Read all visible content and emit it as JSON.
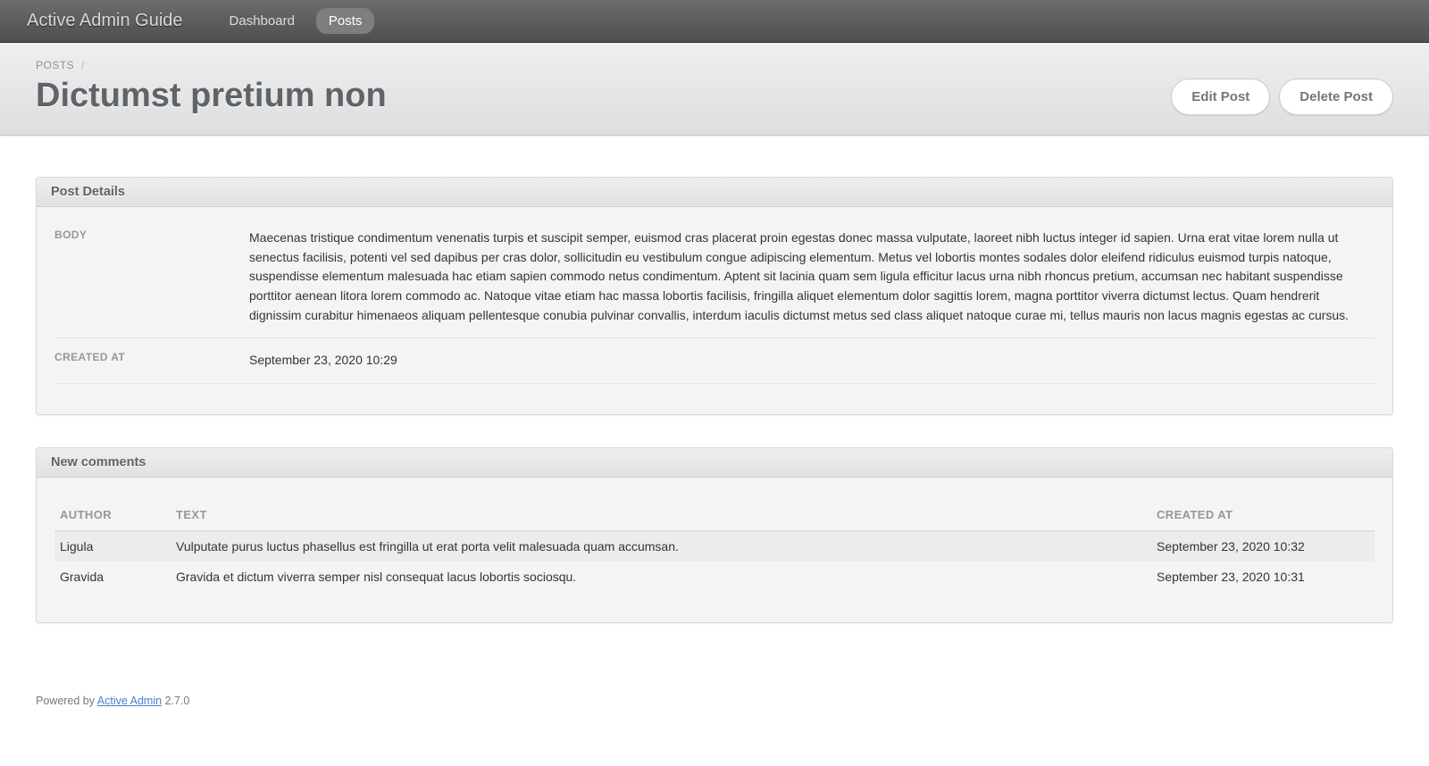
{
  "header": {
    "site_title": "Active Admin Guide",
    "nav": [
      {
        "label": "Dashboard",
        "active": false
      },
      {
        "label": "Posts",
        "active": true
      }
    ]
  },
  "breadcrumb": {
    "items": [
      {
        "label": "POSTS"
      }
    ],
    "sep": "/"
  },
  "page_title": "Dictumst pretium non",
  "actions": {
    "edit": "Edit Post",
    "delete": "Delete Post"
  },
  "panels": {
    "details": {
      "title": "Post Details",
      "rows": {
        "body_label": "BODY",
        "body_value": "Maecenas tristique condimentum venenatis turpis et suscipit semper, euismod cras placerat proin egestas donec massa vulputate, laoreet nibh luctus integer id sapien. Urna erat vitae lorem nulla ut senectus facilisis, potenti vel sed dapibus per cras dolor, sollicitudin eu vestibulum congue adipiscing elementum. Metus vel lobortis montes sodales dolor eleifend ridiculus euismod turpis natoque, suspendisse elementum malesuada hac etiam sapien commodo netus condimentum. Aptent sit lacinia quam sem ligula efficitur lacus urna nibh rhoncus pretium, accumsan nec habitant suspendisse porttitor aenean litora lorem commodo ac. Natoque vitae etiam hac massa lobortis facilisis, fringilla aliquet elementum dolor sagittis lorem, magna porttitor viverra dictumst lectus. Quam hendrerit dignissim curabitur himenaeos aliquam pellentesque conubia pulvinar convallis, interdum iaculis dictumst metus sed class aliquet natoque curae mi, tellus mauris non lacus magnis egestas ac cursus.",
        "created_label": "CREATED AT",
        "created_value": "September 23, 2020 10:29"
      }
    },
    "comments": {
      "title": "New comments",
      "columns": {
        "author": "AUTHOR",
        "text": "TEXT",
        "created": "CREATED AT"
      },
      "rows": [
        {
          "author": "Ligula",
          "text": "Vulputate purus luctus phasellus est fringilla ut erat porta velit malesuada quam accumsan.",
          "created": "September 23, 2020 10:32"
        },
        {
          "author": "Gravida",
          "text": "Gravida et dictum viverra semper nisl consequat lacus lobortis sociosqu.",
          "created": "September 23, 2020 10:31"
        }
      ]
    }
  },
  "footer": {
    "prefix": "Powered by ",
    "link": "Active Admin",
    "suffix": " 2.7.0"
  }
}
